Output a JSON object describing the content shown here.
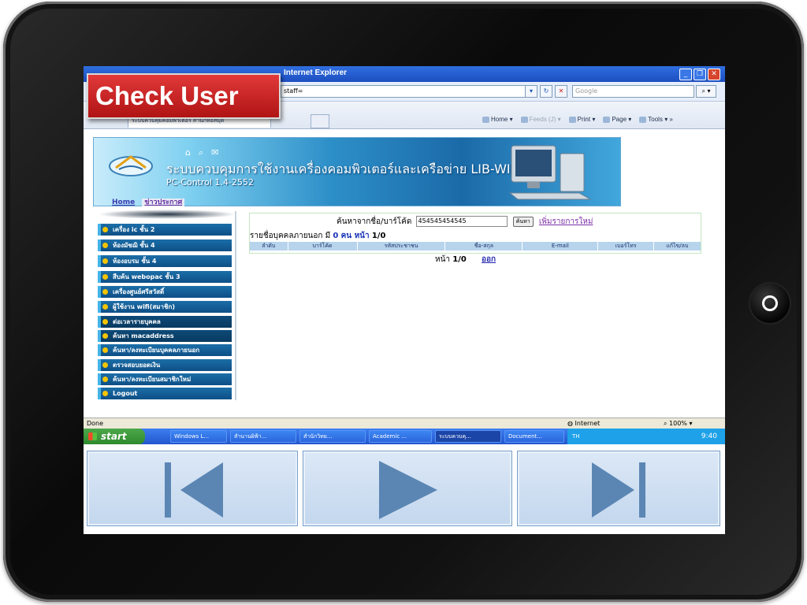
{
  "overlay_title": "Check User",
  "browser": {
    "title_fragment": "Internet Explorer",
    "address_fragment": "staff=",
    "search_placeholder": "Google",
    "tab_label": "ระบบควบคุมคอมพิวเตอร์ สำนักหอสมุด",
    "tools": {
      "home": "Home",
      "feeds": "Feeds (J)",
      "print": "Print",
      "page": "Page",
      "tools": "Tools"
    }
  },
  "banner": {
    "title": "ระบบควบคุมการใช้งานเครื่องคอมพิวเตอร์และเครือข่าย LIB-WIFI",
    "subtitle": "PC-Control 1.4-2552"
  },
  "nav_links": [
    "Home",
    "ข่าวประกาศ"
  ],
  "sidebar_menu": [
    "เครื่อง ic ชั้น 2",
    "ห้องมัชฌิ ชั้น 4",
    "ห้องอบรม ชั้น 4",
    "สืบค้น webopac ชั้น 3",
    "เครื่องศูนย์ศรีสวัสดิ์",
    "ผู้ใช้งาน wifi(สมาชิก)",
    "ต่อเวลารายบุคคล",
    "ค้นหา macaddress",
    "ค้นหา/ลงทะเบียนบุคคลภายนอก",
    "ตรวจสอบยอดเงิน",
    "ค้นหา/ลงทะเบียนสมาชิกใหม่",
    "Logout"
  ],
  "search": {
    "label": "ค้นหาจากชื่อ/บาร์โค้ด",
    "value": "454545454545",
    "button": "ค้นหา",
    "add_link": "เพิ่มรายการใหม่"
  },
  "results": {
    "prefix": "รายชื่อบุคคลภายนอก มี",
    "count": "0",
    "unit": "คน หน้า",
    "page": "1/0",
    "columns": [
      "ลำดับ",
      "บาร์โค้ด",
      "รหัสประชาชน",
      "ชื่อ-สกุล",
      "E-mail",
      "เบอร์โทร",
      "แก้ไข/ลบ"
    ],
    "pager_label": "หน้า",
    "pager_value": "1/0",
    "exit_link": "ออก"
  },
  "statusbar": {
    "left": "Done",
    "zone": "Internet",
    "zoom": "100%"
  },
  "taskbar": {
    "start": "start",
    "tasks": [
      "Windows L...",
      "สำนานผิฟ้า...",
      "สำนักวิทย...",
      "Academic ...",
      "ระบบควบคุ...",
      "Document..."
    ],
    "lang": "TH",
    "time": "9:40"
  },
  "colors": {
    "accent": "#1b6ea8",
    "overlay_red": "#c62424",
    "nav_button": "#c3d7ee",
    "nav_icon": "#5b86b4"
  }
}
